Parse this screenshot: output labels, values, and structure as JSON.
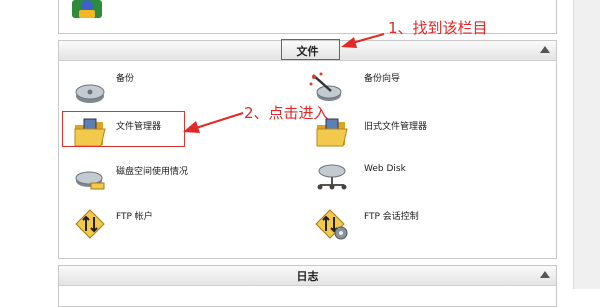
{
  "sections": {
    "files": {
      "title": "文件",
      "items": [
        {
          "label": "备份",
          "icon": "backup-drive-icon"
        },
        {
          "label": "备份向导",
          "icon": "backup-wizard-icon"
        },
        {
          "label": "文件管理器",
          "icon": "file-manager-folder-icon"
        },
        {
          "label": "旧式文件管理器",
          "icon": "legacy-file-manager-folder-icon"
        },
        {
          "label": "磁盘空间使用情况",
          "icon": "disk-usage-icon"
        },
        {
          "label": "Web Disk",
          "icon": "web-disk-icon"
        },
        {
          "label": "FTP 帐户",
          "icon": "ftp-accounts-icon"
        },
        {
          "label": "FTP 会话控制",
          "icon": "ftp-session-control-icon"
        }
      ]
    },
    "logs": {
      "title": "日志"
    }
  },
  "annotations": {
    "step1": "1、找到该栏目",
    "step2": "2、点击进入"
  },
  "colors": {
    "annotation": "#e32828",
    "folder": "#e8b93a",
    "drive": "#9aa3ad"
  }
}
